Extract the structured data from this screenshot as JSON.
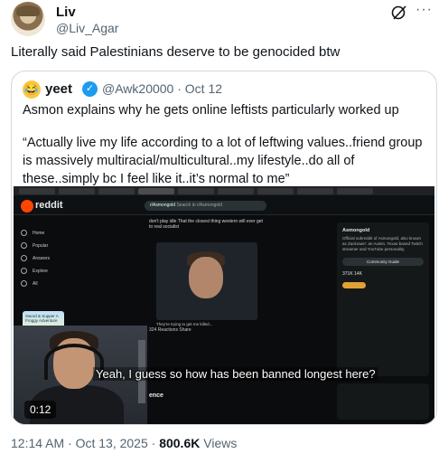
{
  "author": {
    "name": "Liv",
    "handle": "@Liv_Agar"
  },
  "tweet": {
    "text": "Literally said Palestinians deserve to be genocided btw"
  },
  "quote": {
    "name": "yeet",
    "handle": "@Awk20000",
    "date": "· Oct 12",
    "line1": "Asmon explains why he gets online leftists particularly worked up",
    "line2": "“Actually live my life according to a lot of leftwing values..friend group is massively multiracial/multicultural..my lifestyle..do all of these..simply bc I feel like it..it’s normal to me”",
    "video": {
      "subtitle": "Yeah, I guess so how has been banned longest here?",
      "duration": "0:12",
      "reddit_logo": "reddit",
      "search_prefix": "r/Asmongold",
      "search_placeholder": "Search in r/Asmongold",
      "nav": [
        "Home",
        "Popular",
        "Answers",
        "Explore",
        "All"
      ],
      "community_card": "Sword & Supper A Froggy Adventure",
      "post_text": "don't play idle That the closest thing western will ever get to real socialist",
      "post_caption": "They're trying to get me killed...",
      "post_stats": "324 Reactions   Share",
      "sidebar_title": "Asmongold",
      "sidebar_desc": "Official subreddit of Asmongold, also known as Zackrawrr: an Austin, Texas-based Twitch streamer and YouTube personality.",
      "sidebar_button": "Community Guide",
      "sidebar_stats": "371K   14K",
      "chat_hint": "ence"
    }
  },
  "meta": {
    "time": "12:14 AM · Oct 13, 2025 · ",
    "views": "800.6K",
    "views_label": " Views"
  },
  "icons": {
    "grok": "grok-icon",
    "more": "more-icon",
    "verified": "verified-icon"
  }
}
